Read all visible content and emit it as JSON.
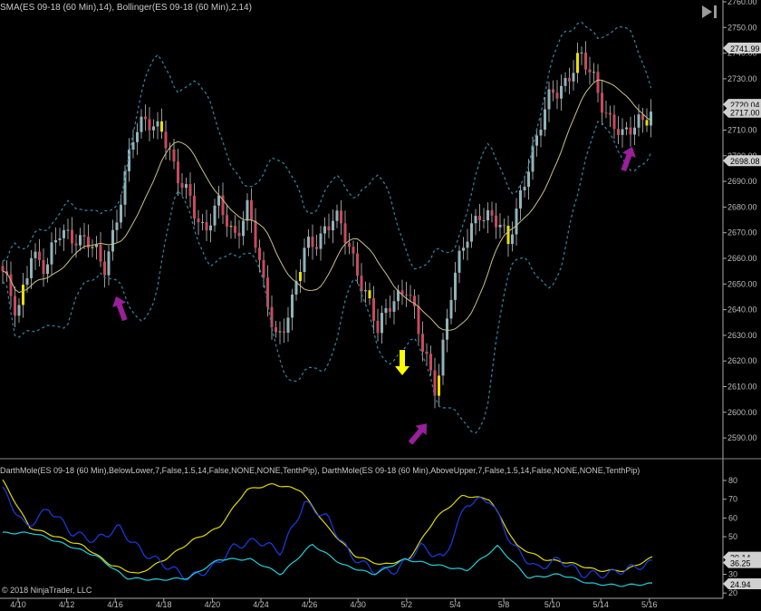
{
  "header": {
    "price_panel_title": "SMA(ES 09-18 (60 Min),14), Bollinger(ES 09-18 (60 Min),2,14)",
    "indicator_panel_title": "DarthMole(ES  09-18  (60  Min),BelowLower,7,False,1.5,14,False,NONE,NONE,TenthPip),  DarthMole(ES  09-18  (60  Min),AboveUpper,7,False,1.5,14,False,NONE,NONE,TenthPip)",
    "copyright": "© 2018 NinjaTrader, LLC"
  },
  "colors": {
    "up": "#8fb3ba",
    "down": "#c84a5c",
    "signal": "#e8e000",
    "sma": "#c8c08a",
    "band": "#2e7f9c",
    "arrow_purple": "#9a1f9a",
    "arrow_yellow": "#ffff00"
  },
  "chart_data": [
    {
      "type": "candlestick",
      "title": "ES 09-18 (60 Min)",
      "ylim": [
        2585,
        2760
      ],
      "y_ticks": [
        "2760.00",
        "2750.00",
        "2740.00",
        "2730.00",
        "2720.00",
        "2710.00",
        "2700.00",
        "2690.00",
        "2680.00",
        "2670.00",
        "2660.00",
        "2650.00",
        "2640.00",
        "2630.00",
        "2620.00",
        "2610.00",
        "2600.00",
        "2590.00"
      ],
      "x_ticks": [
        "4/10",
        "4/12",
        "4/16",
        "4/18",
        "4/20",
        "4/24",
        "4/26",
        "4/30",
        "5/2",
        "5/4",
        "5/8",
        "5/10",
        "5/14",
        "5/16"
      ],
      "approx_close_path": [
        2655,
        2635,
        2665,
        2655,
        2670,
        2670,
        2665,
        2655,
        2680,
        2705,
        2715,
        2712,
        2690,
        2685,
        2670,
        2680,
        2670,
        2680,
        2650,
        2630,
        2640,
        2665,
        2670,
        2675,
        2665,
        2650,
        2630,
        2645,
        2650,
        2625,
        2610,
        2645,
        2665,
        2680,
        2675,
        2665,
        2690,
        2705,
        2725,
        2730,
        2737,
        2730,
        2715,
        2705,
        2715,
        2718
      ],
      "indicators": [
        "SMA 14",
        "Bollinger 2,14"
      ],
      "price_markers": [
        "2741.99",
        "2720.04",
        "2717.00",
        "2698.08"
      ],
      "signal_arrows": [
        {
          "date": "4/16",
          "dir": "up",
          "color": "purple"
        },
        {
          "date": "5/3",
          "dir": "up",
          "color": "purple"
        },
        {
          "date": "5/15",
          "dir": "up",
          "color": "purple"
        },
        {
          "date": "5/1",
          "dir": "down",
          "color": "yellow"
        }
      ]
    },
    {
      "type": "line",
      "title": "DarthMole",
      "ylim": [
        20,
        90
      ],
      "y_ticks": [
        "80",
        "70",
        "60",
        "50",
        "30",
        "20"
      ],
      "series": [
        {
          "name": "yellow",
          "color": "#e0d800",
          "values": [
            80,
            55,
            50,
            45,
            35,
            30,
            38,
            48,
            55,
            75,
            78,
            75,
            55,
            40,
            35,
            38,
            60,
            72,
            70,
            45,
            38,
            36,
            32,
            32,
            39
          ]
        },
        {
          "name": "blue",
          "color": "#1a3ce8",
          "values": [
            75,
            55,
            65,
            52,
            48,
            55,
            42,
            35,
            28,
            33,
            45,
            48,
            42,
            68,
            60,
            40,
            32,
            32,
            45,
            38,
            68,
            70,
            45,
            33,
            38,
            30,
            30,
            33,
            36
          ]
        },
        {
          "name": "cyan",
          "color": "#20d0d8",
          "values": [
            52,
            52,
            46,
            40,
            28,
            27,
            28,
            38,
            38,
            30,
            46,
            35,
            30,
            38,
            35,
            32,
            45,
            28,
            30,
            25,
            24,
            25
          ]
        }
      ],
      "value_markers": [
        "39.14",
        "36.25",
        "24.94"
      ]
    }
  ]
}
